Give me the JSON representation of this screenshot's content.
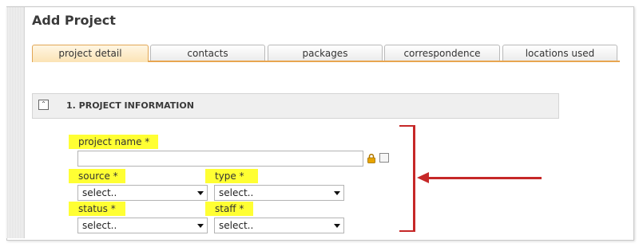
{
  "page": {
    "title": "Add Project"
  },
  "tabs": [
    {
      "label": "project detail",
      "active": true
    },
    {
      "label": "contacts",
      "active": false
    },
    {
      "label": "packages",
      "active": false
    },
    {
      "label": "correspondence",
      "active": false
    },
    {
      "label": "locations used",
      "active": false
    }
  ],
  "section": {
    "title": "1. PROJECT INFORMATION"
  },
  "form": {
    "project_name": {
      "label": "project name *",
      "value": ""
    },
    "source": {
      "label": "source *",
      "value": "select.."
    },
    "type": {
      "label": "type *",
      "value": "select.."
    },
    "status": {
      "label": "status *",
      "value": "select.."
    },
    "staff": {
      "label": "staff *",
      "value": "select.."
    }
  },
  "colors": {
    "highlight": "#ffff33",
    "annotation": "#c62828",
    "tab_accent": "#e8a550"
  },
  "icons": [
    "collapse-icon",
    "lock-icon",
    "checkbox",
    "red-bracket",
    "red-arrow"
  ]
}
